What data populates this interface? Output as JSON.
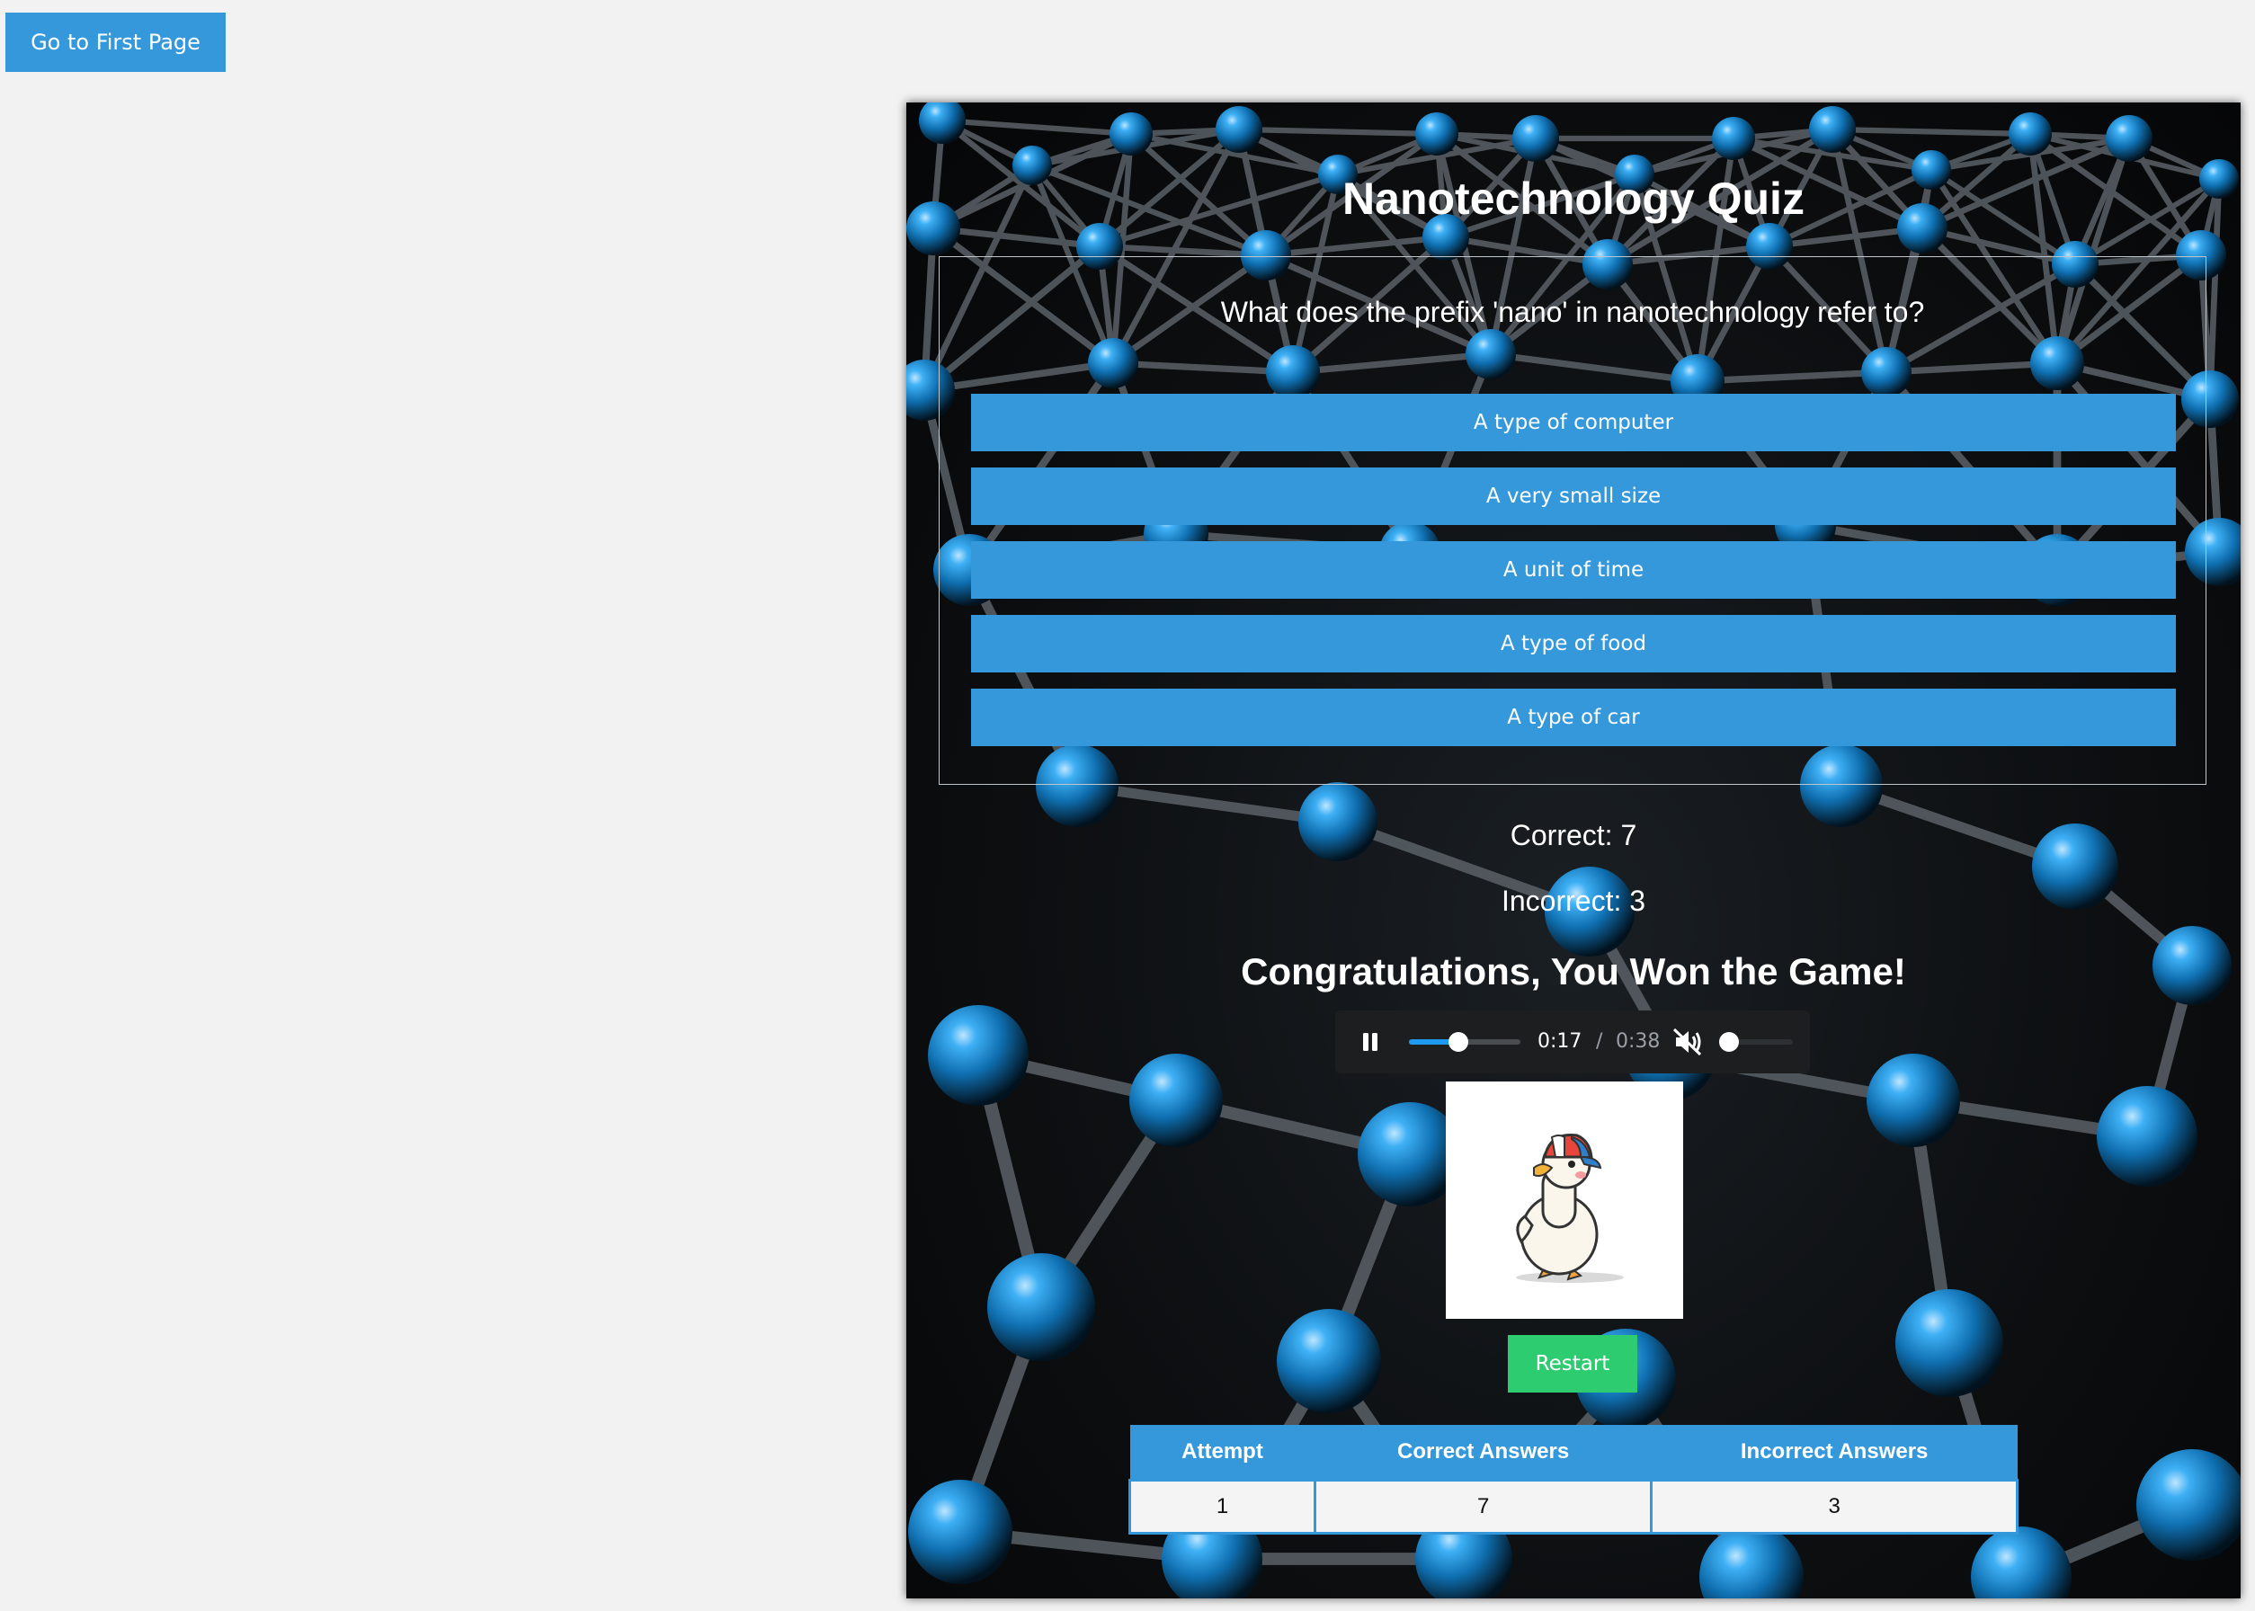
{
  "top_nav": {
    "first_page_label": "Go to First Page"
  },
  "quiz": {
    "title": "Nanotechnology Quiz",
    "question": "What does the prefix 'nano' in nanotechnology refer to?",
    "options": [
      "A type of computer",
      "A very small size",
      "A unit of time",
      "A type of food",
      "A type of car"
    ],
    "correct_label": "Correct: 7",
    "incorrect_label": "Incorrect: 3",
    "win_message": "Congratulations, You Won the Game!",
    "restart_label": "Restart"
  },
  "audio": {
    "state": "playing",
    "current_time": "0:17",
    "separator": "/",
    "total_time": "0:38",
    "progress_fraction": 0.447,
    "muted": true,
    "volume_fraction": 0.0
  },
  "image": {
    "subject": "cartoon duck wearing a red and blue cap"
  },
  "history": {
    "headers": [
      "Attempt",
      "Correct Answers",
      "Incorrect Answers"
    ],
    "rows": [
      [
        "1",
        "7",
        "3"
      ]
    ]
  },
  "colors": {
    "page_background": "#f2f2f2",
    "primary_blue": "#3498db",
    "restart_green": "#2ecc71",
    "sphere_blue": "#1e9bf0",
    "panel_dark": "#0c0e10"
  },
  "icons": {
    "play_state_icon": "pause-icon",
    "volume_icon": "volume-muted-icon"
  }
}
